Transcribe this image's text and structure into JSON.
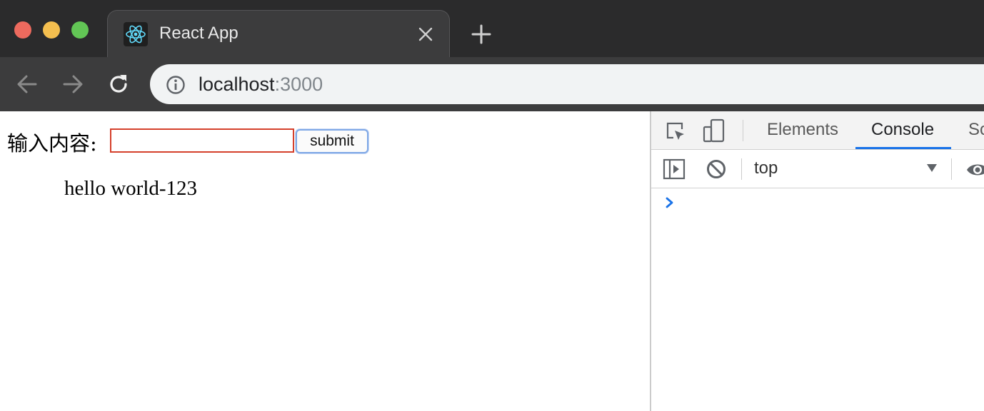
{
  "window": {
    "tab_title": "React App"
  },
  "toolbar": {
    "url_host": "localhost",
    "url_port": ":3000"
  },
  "page": {
    "input_label": "输入内容:",
    "input_value": "",
    "submit_label": "submit",
    "list_items": [
      "hello world-123"
    ]
  },
  "devtools": {
    "tabs": {
      "elements": "Elements",
      "console": "Console",
      "sources": "So"
    },
    "active_tab": "Console",
    "context_select": "top"
  },
  "colors": {
    "titlebar_bg": "#2b2b2c",
    "toolbar_bg": "#3c3c3d",
    "input_border_focus": "#d5402b",
    "button_focus_ring": "#7fa8e6",
    "devtools_active_tab": "#1a73e8",
    "console_prompt": "#1a73e8"
  },
  "icons": {
    "tab_favicon": "react-logo-icon",
    "tab_close": "close-icon",
    "new_tab": "plus-icon",
    "back": "arrow-left-icon",
    "forward": "arrow-right-icon",
    "reload": "reload-icon",
    "site_info": "info-icon",
    "inspect": "inspect-element-icon",
    "device": "device-toolbar-icon",
    "sidebar": "console-sidebar-icon",
    "clear": "clear-console-icon",
    "live_expression": "eye-icon",
    "prompt": "chevron-right-icon"
  }
}
